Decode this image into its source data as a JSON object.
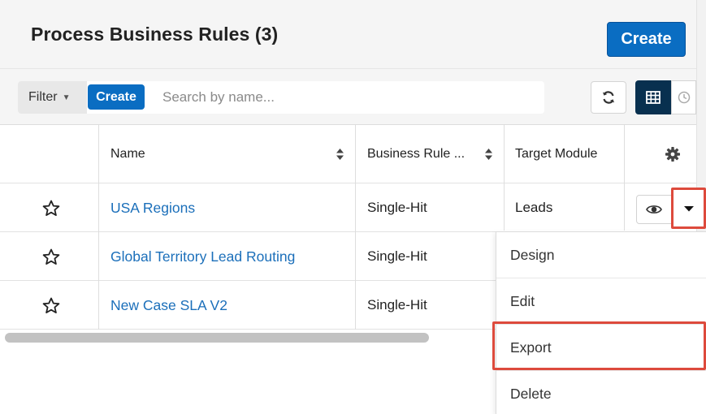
{
  "header": {
    "title": "Process Business Rules (3)",
    "create_label": "Create"
  },
  "filterbar": {
    "filter_label": "Filter",
    "create_label": "Create",
    "search_placeholder": "Search by name..."
  },
  "table": {
    "columns": {
      "name": "Name",
      "business_rule_type": "Business Rule ...",
      "target_module": "Target Module"
    },
    "rows": [
      {
        "name": "USA Regions",
        "business_rule_type": "Single-Hit",
        "target_module": "Leads"
      },
      {
        "name": "Global Territory Lead Routing",
        "business_rule_type": "Single-Hit",
        "target_module": ""
      },
      {
        "name": "New Case SLA V2",
        "business_rule_type": "Single-Hit",
        "target_module": ""
      }
    ]
  },
  "row_actions_menu": {
    "items": [
      "Design",
      "Edit",
      "Export",
      "Delete"
    ]
  },
  "icons": {
    "refresh": "refresh-icon",
    "table_view": "table-view-icon",
    "timeline_view": "clock-icon",
    "settings": "gear-icon",
    "favorite": "star-outline-icon",
    "preview": "eye-icon",
    "actions_caret": "caret-down-icon"
  },
  "colors": {
    "primary": "#0a6dc2",
    "link": "#1b6fba",
    "active_view": "#08304f",
    "highlight": "#dd4a3c"
  }
}
